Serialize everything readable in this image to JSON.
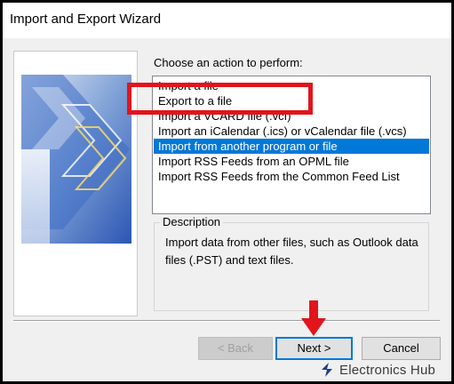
{
  "window": {
    "title": "Import and Export Wizard"
  },
  "prompt": "Choose an action to perform:",
  "actions": [
    {
      "label": "Import a file",
      "selected": false
    },
    {
      "label": "Export to a file",
      "selected": false
    },
    {
      "label": "Import a VCARD file (.vcf)",
      "selected": false
    },
    {
      "label": "Import an iCalendar (.ics) or vCalendar file (.vcs)",
      "selected": false
    },
    {
      "label": "Import from another program or file",
      "selected": true
    },
    {
      "label": "Import RSS Feeds from an OPML file",
      "selected": false
    },
    {
      "label": "Import RSS Feeds from the Common Feed List",
      "selected": false
    }
  ],
  "description": {
    "legend": "Description",
    "text": "Import data from other files, such as Outlook data files (.PST) and text files."
  },
  "buttons": {
    "back": "< Back",
    "next": "Next >",
    "cancel": "Cancel"
  },
  "watermark": {
    "text": "Electronics Hub"
  },
  "colors": {
    "selection": "#0078d7",
    "highlight_annotation": "#e2141c",
    "dialog_background": "#f0f0f0"
  },
  "icons": {
    "wizard_image": "blue-chevron-arrows-graphic",
    "annotation_arrow": "red-down-arrow",
    "watermark_logo": "electronics-hub-logo"
  }
}
